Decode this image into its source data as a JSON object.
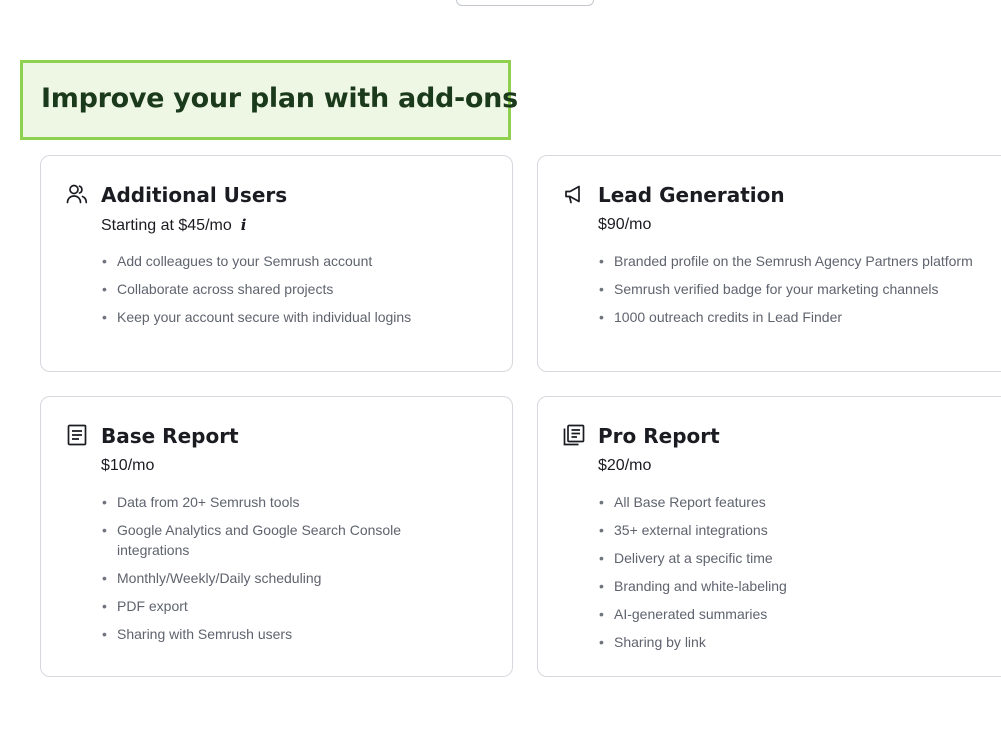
{
  "heading": "Improve your plan with add-ons",
  "cards": [
    {
      "title": "Additional Users",
      "icon": "users-icon",
      "price": "Starting at $45/mo",
      "price_info_icon": "info-icon",
      "features": [
        "Add colleagues to your Semrush account",
        "Collaborate across shared projects",
        "Keep your account secure with individual logins"
      ]
    },
    {
      "title": "Lead Generation",
      "icon": "megaphone-icon",
      "price": "$90/mo",
      "features": [
        "Branded profile on the Semrush Agency Partners platform",
        "Semrush verified badge for your marketing channels",
        "1000 outreach credits in Lead Finder"
      ]
    },
    {
      "title": "Base Report",
      "icon": "document-icon",
      "price": "$10/mo",
      "features": [
        "Data from 20+ Semrush tools",
        "Google Analytics and Google Search Console integrations",
        "Monthly/Weekly/Daily scheduling",
        "PDF export",
        "Sharing with Semrush users"
      ]
    },
    {
      "title": "Pro Report",
      "icon": "documents-icon",
      "price": "$20/mo",
      "features": [
        "All Base Report features",
        "35+ external integrations",
        "Delivery at a specific time",
        "Branding and white-labeling",
        "AI-generated summaries",
        "Sharing by link"
      ]
    }
  ],
  "colors": {
    "heading_border": "#8fd14f",
    "heading_bg": "#eef7e3",
    "heading_text": "#1b3a1c",
    "card_border": "#d6d8de",
    "feature_text": "#5f636e"
  }
}
